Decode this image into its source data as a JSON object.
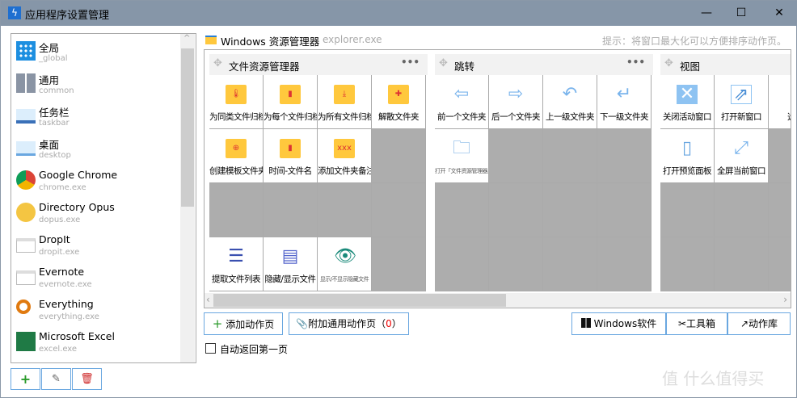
{
  "window": {
    "title": "应用程序设置管理",
    "minimize": "—",
    "maximize": "☐",
    "close": "✕"
  },
  "sidebar": {
    "items": [
      {
        "name": "全局",
        "sub": "_global",
        "icon": "grid-app-icon"
      },
      {
        "name": "通用",
        "sub": "common",
        "icon": "tiles-icon"
      },
      {
        "name": "任务栏",
        "sub": "taskbar",
        "icon": "taskbar-icon"
      },
      {
        "name": "桌面",
        "sub": "desktop",
        "icon": "desktop-icon"
      },
      {
        "name": "Google Chrome",
        "sub": "chrome.exe",
        "icon": "chrome-icon"
      },
      {
        "name": "Directory Opus",
        "sub": "dopus.exe",
        "icon": "dopus-icon"
      },
      {
        "name": "DropIt",
        "sub": "dropit.exe",
        "icon": "window-icon"
      },
      {
        "name": "Evernote",
        "sub": "evernote.exe",
        "icon": "window-icon"
      },
      {
        "name": "Everything",
        "sub": "everything.exe",
        "icon": "magnifier-icon"
      },
      {
        "name": "Microsoft Excel",
        "sub": "excel.exe",
        "icon": "excel-icon"
      }
    ],
    "add": "+",
    "edit": "✎",
    "delete": "🗑"
  },
  "header": {
    "app": "Windows 资源管理器",
    "exe": "explorer.exe",
    "hint": "提示：将窗口最大化可以方便排序动作页。"
  },
  "groups": [
    {
      "title": "文件资源管理器",
      "cells": [
        {
          "label": "为同类文件归档",
          "icon": "folder-zip-icon"
        },
        {
          "label": "为每个文件归档",
          "icon": "folder-doc-icon"
        },
        {
          "label": "为所有文件归档",
          "icon": "folder-download-icon"
        },
        {
          "label": "解散文件夹",
          "icon": "folder-puzzle-icon"
        },
        {
          "label": "创建模板文件夹",
          "icon": "folder-add-icon"
        },
        {
          "label": "时间-文件名",
          "icon": "folder-doc-icon"
        },
        {
          "label": "添加文件夹备注",
          "icon": "folder-xxx-icon"
        },
        null,
        null,
        null,
        null,
        null,
        {
          "label": "提取文件列表",
          "icon": "checklist-icon"
        },
        {
          "label": "隐藏/显示文件",
          "icon": "dashed-doc-icon"
        },
        {
          "label": "显示/不显示隐藏文件",
          "icon": "eye-slash-icon",
          "small": true
        },
        null
      ]
    },
    {
      "title": "跳转",
      "cells": [
        {
          "label": "前一个文件夹",
          "icon": "arrow-left-icon"
        },
        {
          "label": "后一个文件夹",
          "icon": "arrow-right-icon"
        },
        {
          "label": "上一级文件夹",
          "icon": "undo-arrow-icon"
        },
        {
          "label": "下一级文件夹",
          "icon": "enter-arrow-icon"
        },
        {
          "label": "打开「文件资源管理器」",
          "icon": "open-folder-icon",
          "small": true
        },
        null,
        null,
        null,
        null,
        null,
        null,
        null,
        null,
        null,
        null,
        null
      ]
    },
    {
      "title": "视图",
      "cells": [
        {
          "label": "关闭活动窗口",
          "icon": "close-box-icon"
        },
        {
          "label": "打开新窗口",
          "icon": "new-window-icon"
        },
        {
          "label": "选择",
          "icon": "window-icon"
        },
        null,
        {
          "label": "打开预览面板",
          "icon": "preview-pane-icon"
        },
        {
          "label": "全屏当前窗口",
          "icon": "fullscreen-icon"
        },
        null,
        null,
        null,
        null,
        null,
        null,
        null,
        null,
        null,
        null
      ]
    }
  ],
  "buttons": {
    "add_page": "添加动作页",
    "attach_common": "附加通用动作页（",
    "attach_count": "0",
    "attach_close": "）",
    "windows_software": "Windows软件",
    "toolbox": "工具箱",
    "action_library": "动作库"
  },
  "auto_return": {
    "label": "自动返回第一页",
    "checked": false
  },
  "watermark": "值 什么值得买"
}
